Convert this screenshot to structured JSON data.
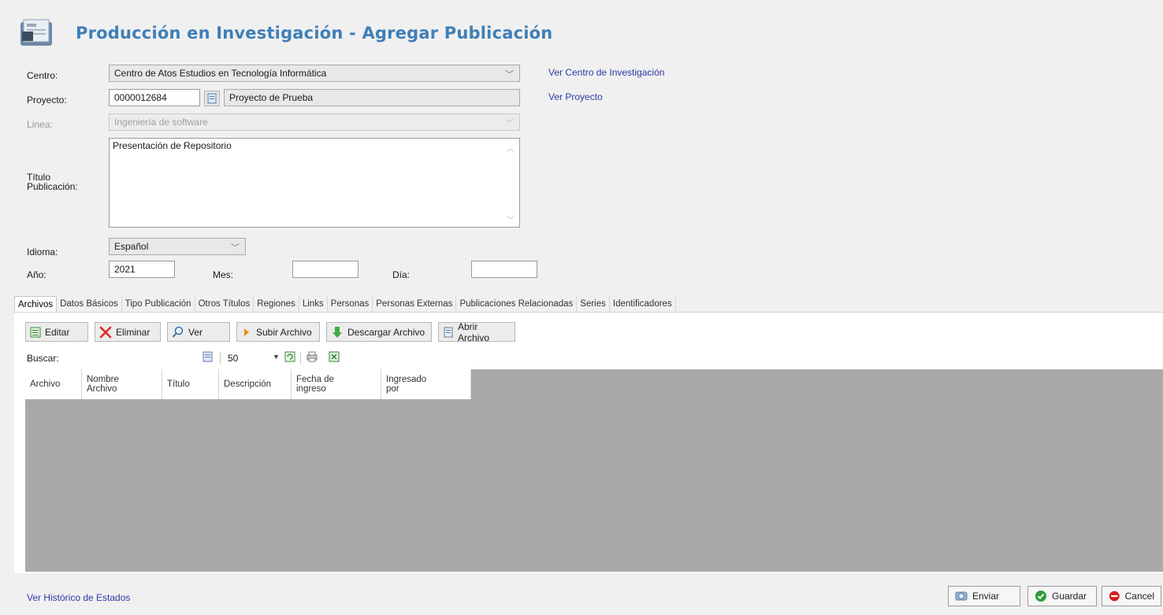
{
  "header": {
    "title": "Producción en Investigación - Agregar Publicación",
    "icon": "document-stack-icon"
  },
  "form": {
    "centro": {
      "label": "Centro:",
      "value": "Centro de Atos Estudios en Tecnología Informática",
      "link": "Ver Centro de Investigación"
    },
    "proyecto": {
      "label": "Proyecto:",
      "code": "0000012684",
      "name": "Proyecto de Prueba",
      "link": "Ver Proyecto"
    },
    "linea": {
      "label": "Linea:",
      "value": "Ingeniería de software"
    },
    "titulo": {
      "label_1": "Título",
      "label_2": "Publicación:",
      "value": "Presentación de Repositorio"
    },
    "idioma": {
      "label": "Idioma:",
      "value": "Español"
    },
    "anio": {
      "label": "Año:",
      "value": "2021"
    },
    "mes": {
      "label": "Mes:",
      "value": ""
    },
    "dia": {
      "label": "Día:",
      "value": ""
    }
  },
  "tabs": [
    "Archivos",
    "Datos Básicos",
    "Tipo Publicación",
    "Otros Títulos",
    "Regiones",
    "Links",
    "Personas",
    "Personas Externas",
    "Publicaciones Relacionadas",
    "Series",
    "Identificadores"
  ],
  "toolbar": {
    "editar": "Editar",
    "eliminar": "Eliminar",
    "ver": "Ver",
    "subir": "Subir Archivo",
    "descargar": "Descargar Archivo",
    "abrir": "Abrir Archivo"
  },
  "search": {
    "label": "Buscar:",
    "page_size": "50"
  },
  "grid": {
    "columns": [
      [
        "Archivo"
      ],
      [
        "Nombre",
        "Archivo"
      ],
      [
        "Título"
      ],
      [
        "Descripción"
      ],
      [
        "Fecha de",
        "ingreso"
      ],
      [
        "Ingresado",
        "por"
      ]
    ]
  },
  "footer": {
    "historico": "Ver Histórico de Estados",
    "enviar": "Enviar",
    "guardar": "Guardar",
    "cancel": "Cancel"
  },
  "colors": {
    "title": "#3f7fb7",
    "link": "#2b3aa6",
    "grid_bg": "#a9a9a9",
    "cancel_red": "#d22020",
    "save_green": "#2e9b3a"
  }
}
